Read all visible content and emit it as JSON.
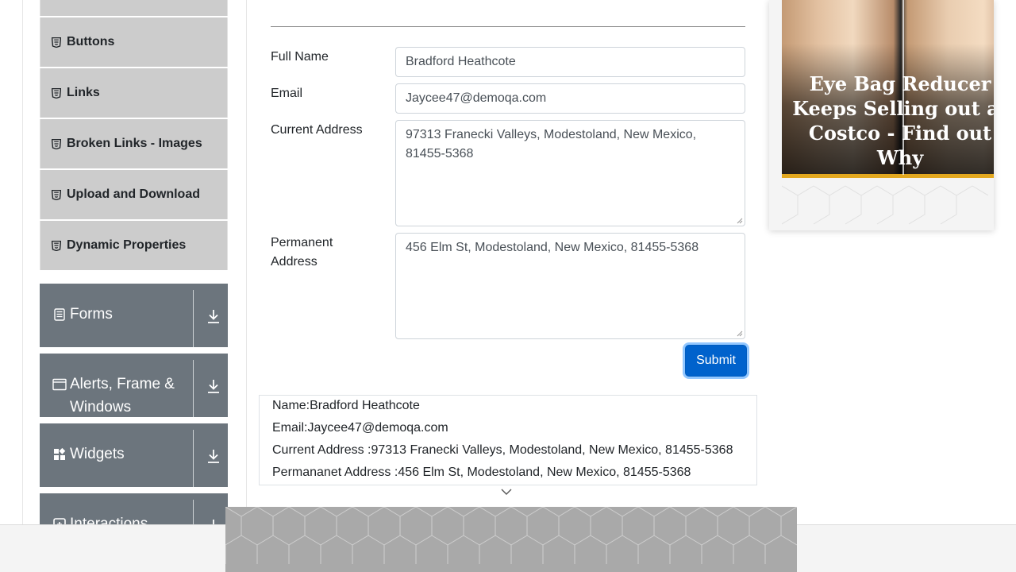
{
  "sidebar": {
    "elements_items": [
      {
        "label": "Buttons"
      },
      {
        "label": "Links"
      },
      {
        "label": "Broken Links - Images"
      },
      {
        "label": "Upload and Download"
      },
      {
        "label": "Dynamic Properties"
      }
    ],
    "groups": [
      {
        "label": "Forms",
        "icon": "form-icon"
      },
      {
        "label": "Alerts, Frame & Windows",
        "icon": "window-icon"
      },
      {
        "label": "Widgets",
        "icon": "widgets-icon"
      },
      {
        "label": "Interactions",
        "icon": "interactions-icon"
      }
    ]
  },
  "form": {
    "full_name_label": "Full Name",
    "full_name_value": "Bradford Heathcote",
    "email_label": "Email",
    "email_value": "Jaycee47@demoqa.com",
    "current_address_label": "Current Address",
    "current_address_value": "97313 Franecki Valleys, Modestoland, New Mexico, 81455-5368",
    "permanent_address_label": "Permanent Address",
    "permanent_address_value": "456 Elm St, Modestoland, New Mexico, 81455-5368",
    "submit_label": "Submit"
  },
  "output": {
    "name": "Name:Bradford Heathcote",
    "email": "Email:Jaycee47@demoqa.com",
    "current_address": "Current Address :97313 Franecki Valleys, Modestoland, New Mexico, 81455-5368",
    "permanent_address": "Permananet Address :456 Elm St, Modestoland, New Mexico, 81455-5368"
  },
  "ad": {
    "headline": "Eye Bag Reducer Keeps Selling out at Costco - Find out Why",
    "accent_color": "#e3a81f"
  },
  "colors": {
    "sidebar_group_bg": "#6c757d",
    "sidebar_item_bg": "#cccccc",
    "submit_bg": "#0062cc"
  }
}
